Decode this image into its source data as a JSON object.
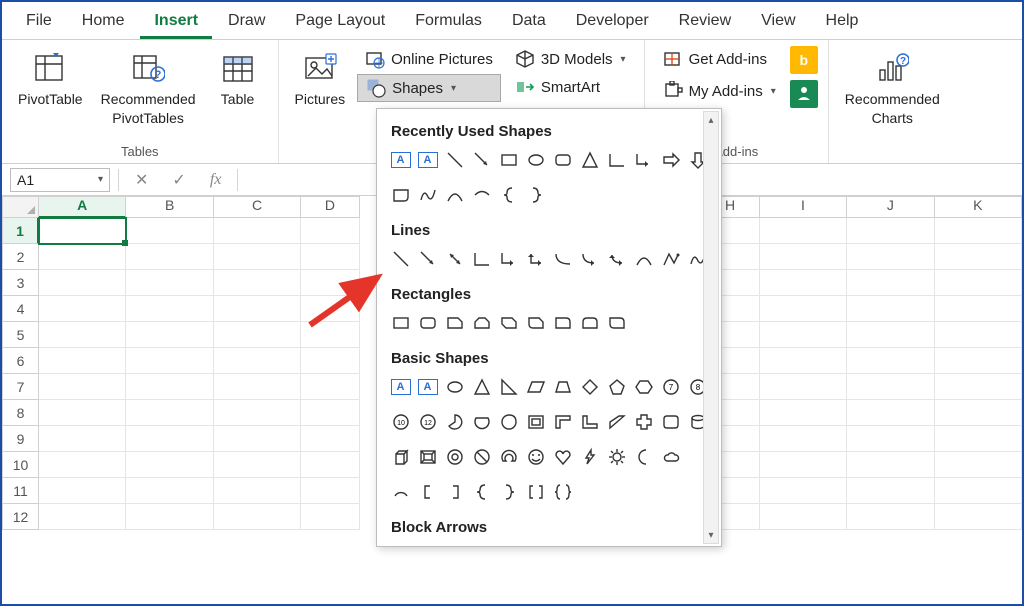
{
  "tabs": {
    "file": "File",
    "home": "Home",
    "insert": "Insert",
    "draw": "Draw",
    "page_layout": "Page Layout",
    "formulas": "Formulas",
    "data": "Data",
    "developer": "Developer",
    "review": "Review",
    "view": "View",
    "help": "Help"
  },
  "ribbon": {
    "tables": {
      "pivot": "PivotTable",
      "rec_pivot_1": "Recommended",
      "rec_pivot_2": "PivotTables",
      "table": "Table",
      "group_label": "Tables"
    },
    "illustrations": {
      "pictures": "Pictures",
      "online_pictures": "Online Pictures",
      "shapes": "Shapes",
      "threed": "3D Models",
      "smartart": "SmartArt"
    },
    "addins": {
      "get": "Get Add-ins",
      "my": "My Add-ins",
      "group_label": "Add-ins"
    },
    "charts": {
      "rec_charts_1": "Recommended",
      "rec_charts_2": "Charts"
    }
  },
  "fbar": {
    "namebox": "A1"
  },
  "grid": {
    "columns": [
      "A",
      "B",
      "C",
      "D",
      "H",
      "I",
      "J",
      "K"
    ],
    "rows": [
      "1",
      "2",
      "3",
      "4",
      "5",
      "6",
      "7",
      "8",
      "9",
      "10",
      "11",
      "12"
    ]
  },
  "shapes_menu": {
    "recent": "Recently Used Shapes",
    "lines": "Lines",
    "rectangles": "Rectangles",
    "basic": "Basic Shapes",
    "block": "Block Arrows"
  }
}
